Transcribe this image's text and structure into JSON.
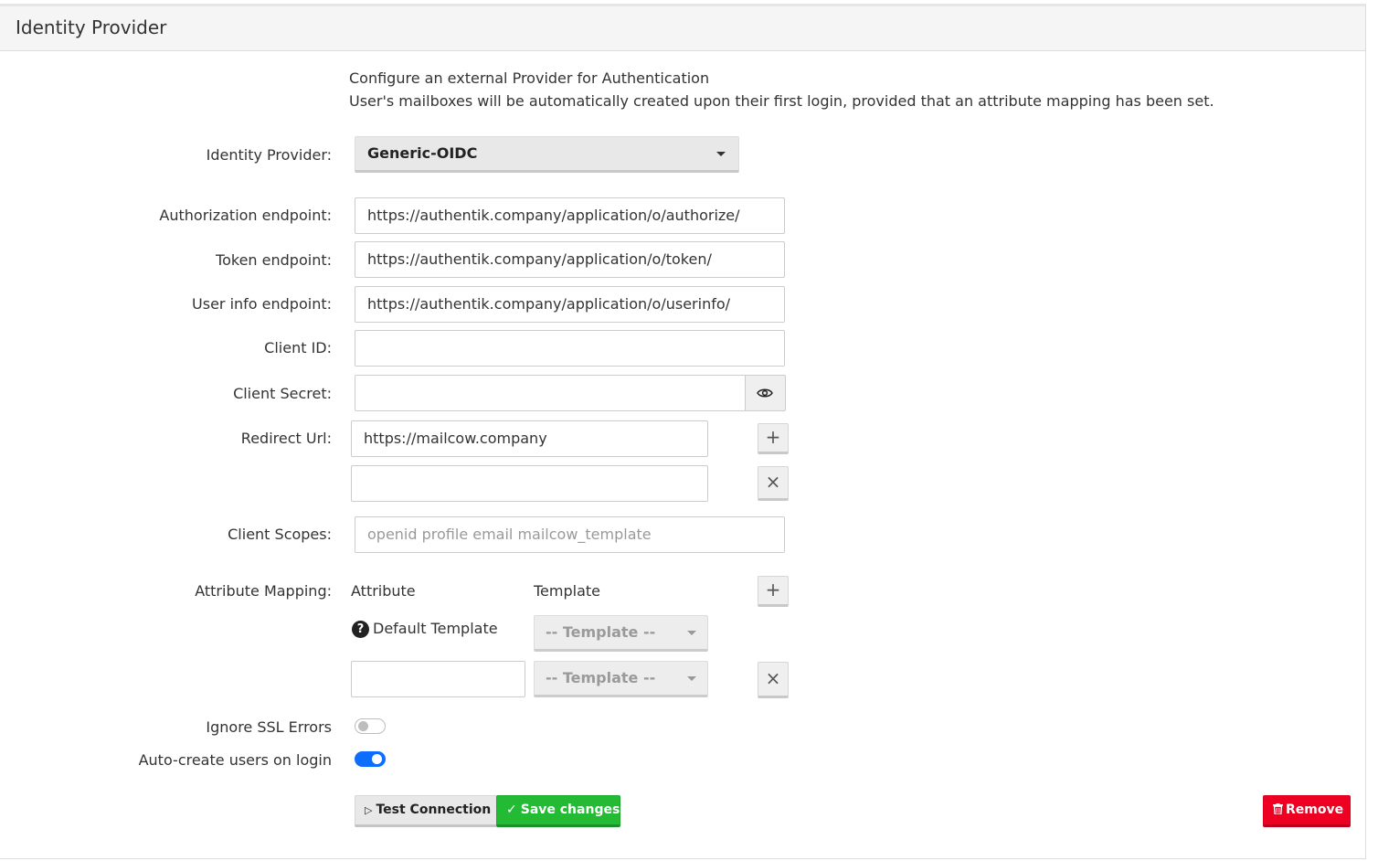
{
  "panel": {
    "title": "Identity Provider"
  },
  "intro": {
    "line1": "Configure an external Provider for Authentication",
    "line2": "User's mailboxes will be automatically created upon their first login, provided that an attribute mapping has been set."
  },
  "fields": {
    "identity_provider": {
      "label": "Identity Provider:",
      "value": "Generic-OIDC"
    },
    "authorization_endpoint": {
      "label": "Authorization endpoint:",
      "value": "https://authentik.company/application/o/authorize/"
    },
    "token_endpoint": {
      "label": "Token endpoint:",
      "value": "https://authentik.company/application/o/token/"
    },
    "userinfo_endpoint": {
      "label": "User info endpoint:",
      "value": "https://authentik.company/application/o/userinfo/"
    },
    "client_id": {
      "label": "Client ID:",
      "value": ""
    },
    "client_secret": {
      "label": "Client Secret:",
      "value": ""
    },
    "redirect_url": {
      "label": "Redirect Url:",
      "values": [
        "https://mailcow.company",
        ""
      ]
    },
    "client_scopes": {
      "label": "Client Scopes:",
      "value": "",
      "placeholder": "openid profile email mailcow_template"
    }
  },
  "attribute_mapping": {
    "label": "Attribute Mapping:",
    "col_attribute": "Attribute",
    "col_template": "Template",
    "default_row_label": "Default Template",
    "template_placeholder": "-- Template --",
    "row_attribute_value": ""
  },
  "toggles": {
    "ignore_ssl": {
      "label": "Ignore SSL Errors",
      "checked": false
    },
    "auto_create": {
      "label": "Auto-create users on login",
      "checked": true
    }
  },
  "buttons": {
    "test_connection": "Test Connection",
    "save_changes": "Save changes",
    "remove": "Remove",
    "plus": "+",
    "close": "×"
  },
  "icons": {
    "help": "?",
    "test_icon": "▷",
    "save_icon": "✓",
    "remove_icon": "trash-icon"
  },
  "colors": {
    "save": "#22bb33",
    "remove": "#ee0022",
    "toggle_on": "#0d6efd"
  }
}
